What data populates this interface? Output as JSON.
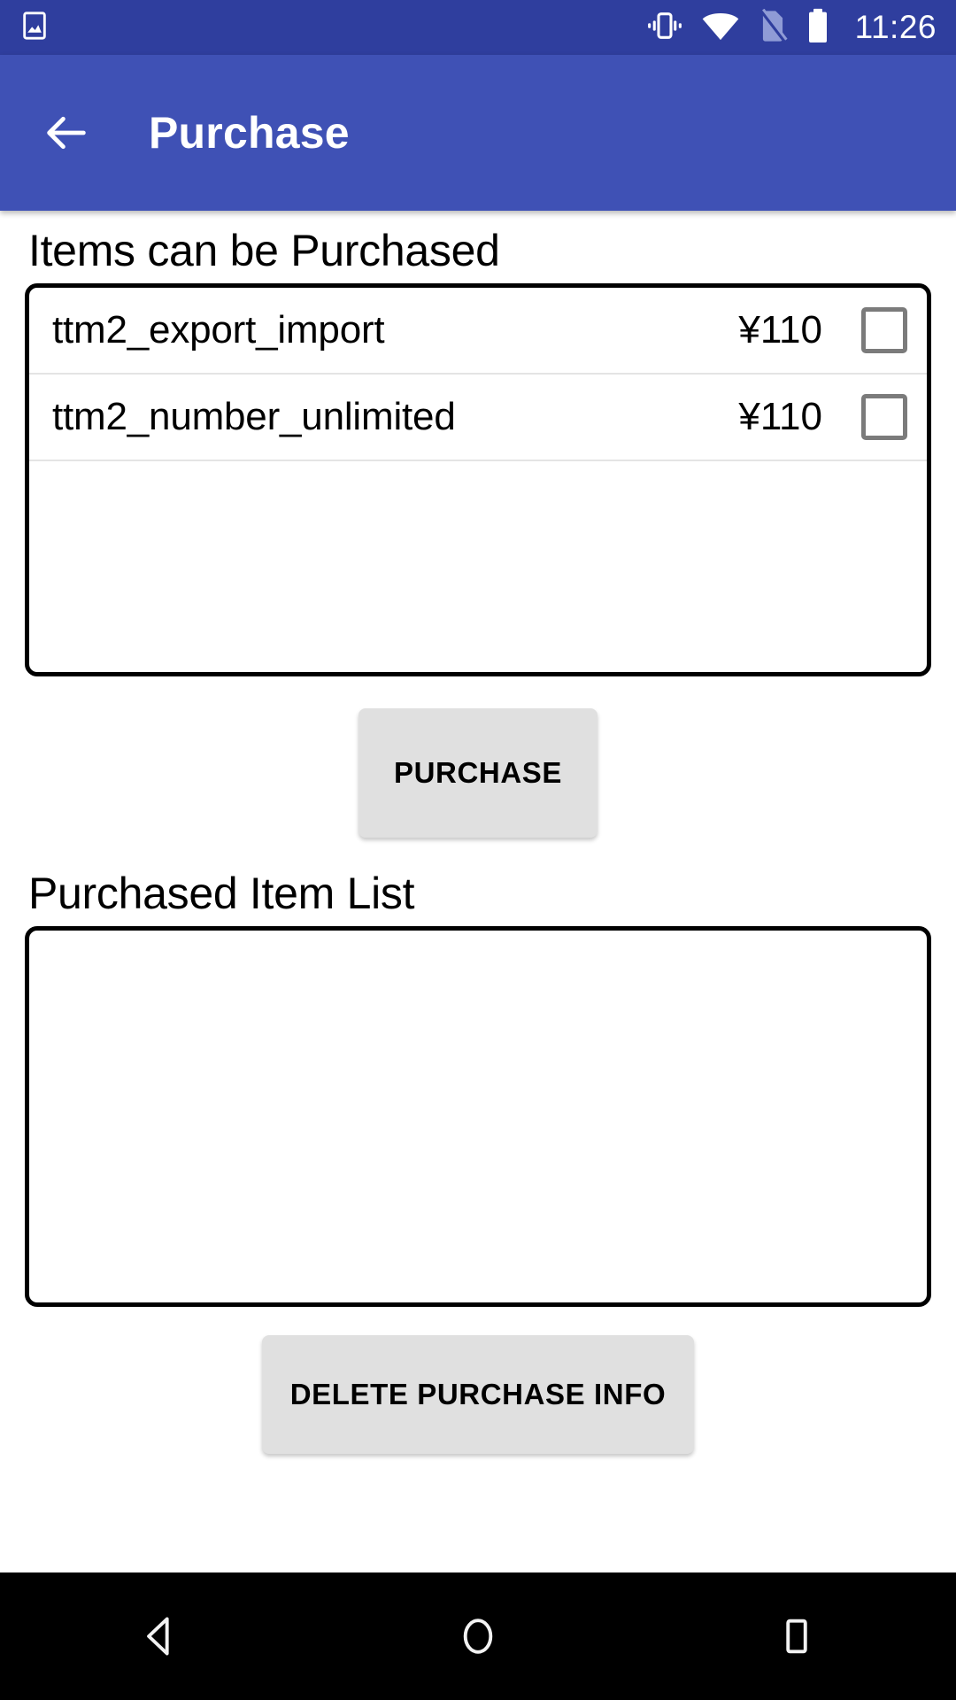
{
  "status_bar": {
    "icons": [
      "image-icon",
      "vibrate-icon",
      "wifi-icon",
      "sim-card-off-icon",
      "battery-full-icon"
    ],
    "clock": "11:26",
    "background_color": "#2f3e9e"
  },
  "app_bar": {
    "back_label": "back-arrow-icon",
    "title": "Purchase",
    "background_color": "#3f51b5"
  },
  "sections": {
    "available": {
      "heading": "Items can be Purchased",
      "items": [
        {
          "name": "ttm2_export_import",
          "price": "¥110",
          "checked": false
        },
        {
          "name": "ttm2_number_unlimited",
          "price": "¥110",
          "checked": false
        }
      ]
    },
    "purchased": {
      "heading": "Purchased Item List",
      "items": []
    }
  },
  "buttons": {
    "purchase": "PURCHASE",
    "delete": "DELETE PURCHASE INFO",
    "background_color": "#e0e0e0"
  },
  "nav_bar": {
    "back": "nav-back-icon",
    "home": "nav-home-icon",
    "recents": "nav-recents-icon",
    "background_color": "#000000"
  }
}
